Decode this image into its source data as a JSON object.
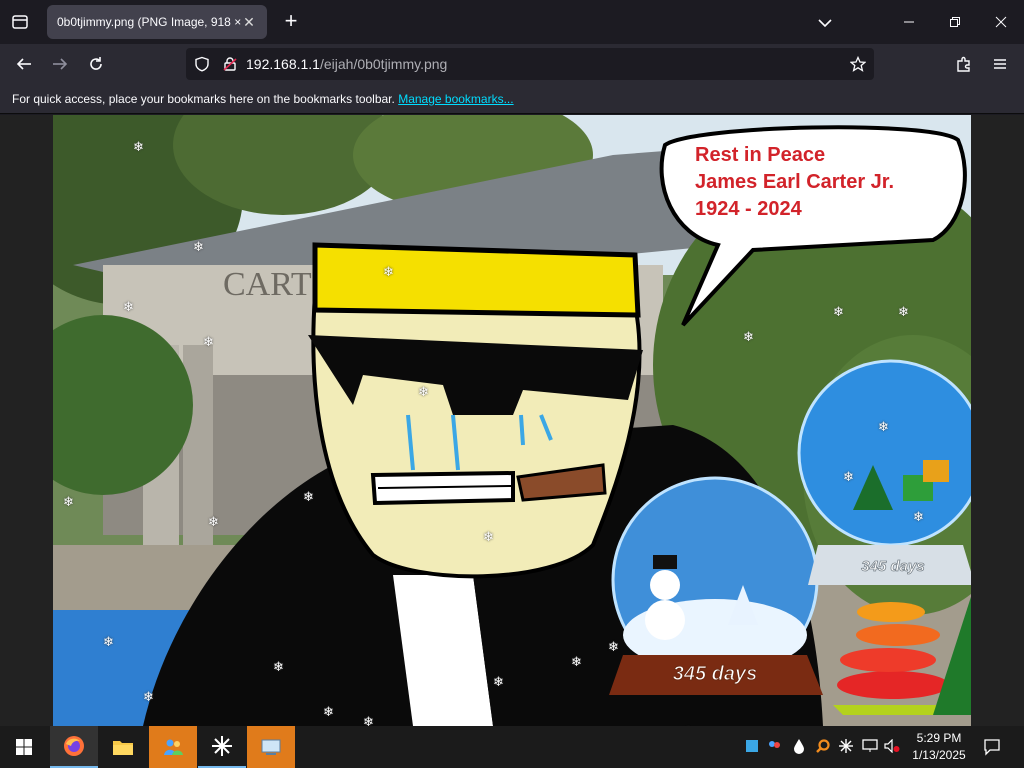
{
  "browser": {
    "tab_title": "0b0tjimmy.png (PNG Image, 918 ×",
    "url_host": "192.168.1.1",
    "url_path": "/eijah/0b0tjimmy.png",
    "bookmarks_message": "For quick access, place your bookmarks here on the bookmarks toolbar.",
    "manage_bookmarks": "Manage bookmarks..."
  },
  "image": {
    "building_sign": "CARTER CENTENTIAL",
    "speech_line1": "Rest in Peace",
    "speech_line2": "James Earl Carter Jr.",
    "speech_line3": "1924 - 2024",
    "globe_label_1": "345 days",
    "globe_label_2": "345 days"
  },
  "taskbar": {
    "time": "5:29 PM",
    "date": "1/13/2025",
    "items": [
      "start",
      "firefox",
      "file-explorer",
      "app-1",
      "app-2",
      "app-3"
    ]
  },
  "colors": {
    "accent": "#00ddff",
    "speech_text": "#d2232a",
    "hat": "#f5e000",
    "skin": "#f2ecb8"
  }
}
